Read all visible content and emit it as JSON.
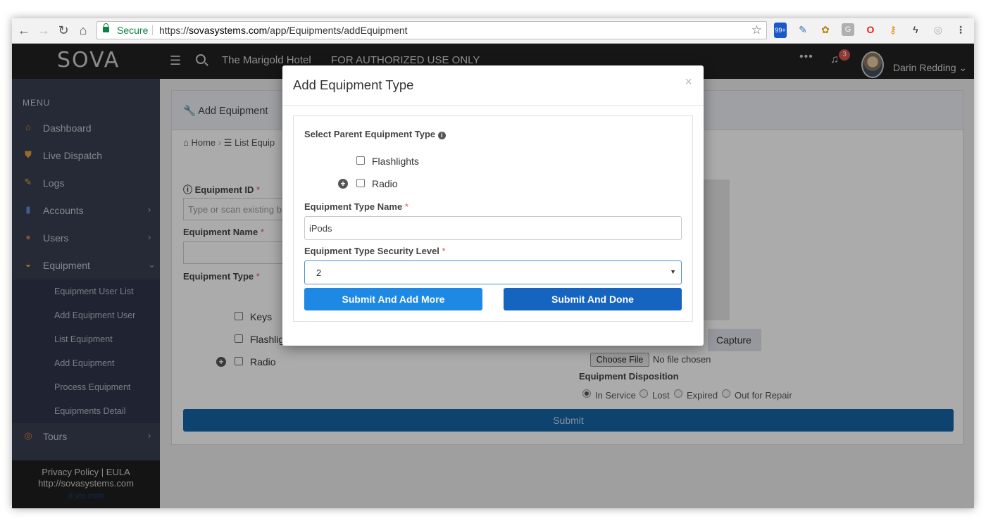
{
  "browser": {
    "secure_label": "Secure",
    "url_prefix": "https://",
    "url_host": "sovasystems.com",
    "url_path": "/app/Equipments/addEquipment",
    "ext_badge": "99+"
  },
  "header": {
    "logo": "SOVA",
    "hotel": "The Marigold Hotel",
    "notice": "FOR AUTHORIZED USE ONLY",
    "more": "•••",
    "notification_count": "3",
    "user_name": "Darin Redding"
  },
  "sidebar": {
    "menu_title": "MENU",
    "items": [
      {
        "label": "Dashboard",
        "icon": "home-icon"
      },
      {
        "label": "Live Dispatch",
        "icon": "shield-icon"
      },
      {
        "label": "Logs",
        "icon": "pencil-icon"
      },
      {
        "label": "Accounts",
        "icon": "book-icon"
      },
      {
        "label": "Users",
        "icon": "user-icon"
      },
      {
        "label": "Equipment",
        "icon": "hardhat-icon"
      },
      {
        "label": "Tours",
        "icon": "compass-icon"
      }
    ],
    "sub_items": [
      "Equipment User List",
      "Add Equipment User",
      "List Equipment",
      "Add Equipment",
      "Process Equipment",
      "Equipments Detail"
    ],
    "footer": {
      "privacy": "Privacy Policy",
      "eula": "EULA",
      "site": "http://sovasystems.com",
      "hidden_link": "d.vis.com"
    }
  },
  "page": {
    "title": "Add Equipment",
    "breadcrumb_home": "Home",
    "breadcrumb_list": "List Equip",
    "equipment_id_label": "Equipment ID",
    "equipment_id_placeholder": "Type or scan existing b",
    "equipment_name_label": "Equipment Name",
    "equipment_type_label": "Equipment Type",
    "types": [
      "Keys",
      "Flashlig",
      "Radio"
    ],
    "capture_label": "Capture",
    "choose_file": "Choose File",
    "no_file": "No file chosen",
    "disposition_label": "Equipment Disposition",
    "dispositions": [
      "In Service",
      "Lost",
      "Expired",
      "Out for Repair"
    ],
    "submit_label": "Submit"
  },
  "modal": {
    "title": "Add Equipment Type",
    "close": "×",
    "parent_label": "Select Parent Equipment Type",
    "parent_options": [
      "Flashlights",
      "Radio"
    ],
    "type_name_label": "Equipment Type Name",
    "type_name_value": "iPods",
    "security_label": "Equipment Type Security Level",
    "security_value": "2",
    "btn_add_more": "Submit And Add More",
    "btn_done": "Submit And Done",
    "colors": {
      "btn_add_more": "#1e88e5",
      "btn_done": "#1565c0",
      "accent": "#4a90d9"
    }
  }
}
